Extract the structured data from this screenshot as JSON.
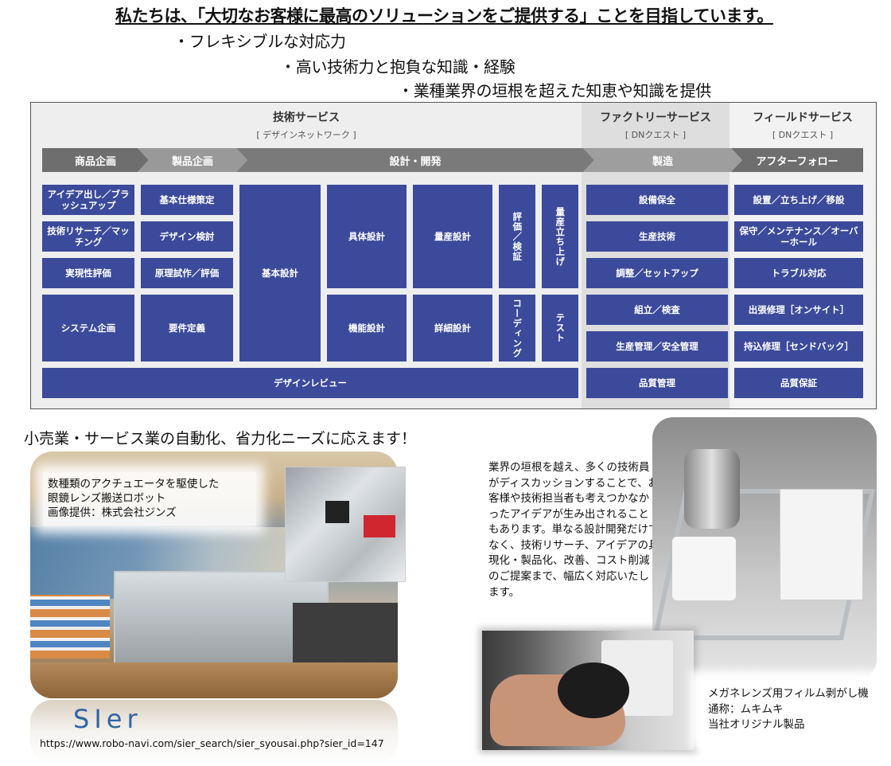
{
  "headline": "私たちは、「大切なお客様に最高のソリューションをご提供する」ことを目指しています。",
  "bullets": [
    "・フレキシブルな対応力",
    "・高い技術力と抱負な知識・経験",
    "・業種業界の垣根を超えた知恵や知識を提供"
  ],
  "diagram": {
    "services": [
      {
        "title": "技術サービス",
        "sub": "[ デザインネットワーク ]"
      },
      {
        "title": "ファクトリーサービス",
        "sub": "[ DNクエスト ]"
      },
      {
        "title": "フィールドサービス",
        "sub": "[ DNクエスト ]"
      }
    ],
    "phases": [
      {
        "label": "商品企画",
        "color": "#6e6e6e"
      },
      {
        "label": "製品企画",
        "color": "#999999"
      },
      {
        "label": "設計・開発",
        "color": "#7a7a7a"
      },
      {
        "label": "製造",
        "color": "#9e9e9e"
      },
      {
        "label": "アフターフォロー",
        "color": "#6e6e6e"
      }
    ],
    "box_color": "#3b4a9a",
    "product_planning": [
      "アイデア出し／ブラッシュアップ",
      "技術リサーチ／マッチング",
      "実現性評価",
      "システム企画"
    ],
    "product_design": [
      "基本仕様策定",
      "デザイン検討",
      "原理試作／評価",
      "要件定義"
    ],
    "development": {
      "basic_design": "基本設計",
      "concrete_design": "具体設計",
      "mass_design": "量産設計",
      "evaluation": "評価／検証",
      "mass_startup": "量産立ち上げ",
      "function_design": "機能設計",
      "detail_design": "詳細設計",
      "coding": "コーディング",
      "test": "テスト",
      "design_review": "デザインレビュー"
    },
    "factory": [
      "設備保全",
      "生産技術",
      "調整／セットアップ",
      "組立／検査",
      "生産管理／安全管理",
      "品質管理"
    ],
    "field": [
      "設置／立ち上げ／移設",
      "保守／メンテナンス／オーバーホール",
      "トラブル対応",
      "出張修理［オンサイト］",
      "持込修理［センドバック］",
      "品質保証"
    ]
  },
  "retail_heading": "小売業・サービス業の自動化、省力化ニーズに応えます！",
  "jins_caption": [
    "数種類のアクチュエータを駆使した",
    "眼鏡レンズ搬送ロボット",
    "画像提供：株式会社ジンズ"
  ],
  "sier": {
    "logo": "SIer",
    "url": "https://www.robo-navi.com/sier_search/sier_syousai.php?sier_id=147"
  },
  "description": "業界の垣根を越え、多くの技術員がディスカッションすることで、お客様や技術担当者も考えつかなかったアイデアが生み出されることもあります。単なる設計開発だけでなく、技術リサーチ、アイデアの具現化・製品化、改善、コスト削減のご提案まで、幅広く対応いたします。",
  "mukimuki_caption": [
    "メガネレンズ用フィルム剥がし機",
    "通称：ムキムキ",
    "当社オリジナル製品"
  ]
}
